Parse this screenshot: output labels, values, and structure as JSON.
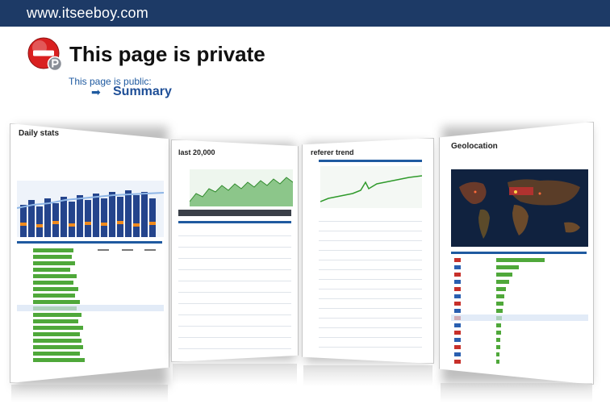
{
  "header": {
    "site": "www.itseeboy.com"
  },
  "notice": {
    "title": "This page is private",
    "public_label": "This page is public:",
    "summary_arrow": "➡",
    "summary_link": "Summary"
  },
  "gallery": {
    "panels": [
      {
        "title": "Daily stats"
      },
      {
        "title": "last 20,000"
      },
      {
        "title": "referer trend"
      },
      {
        "title": "Geolocation"
      }
    ]
  },
  "colors": {
    "header_bg": "#1d3a66",
    "link": "#1f5aa0",
    "private_red": "#d92020"
  },
  "icons": {
    "private": "private-stop-icon",
    "arrow": "arrow-right-icon"
  }
}
